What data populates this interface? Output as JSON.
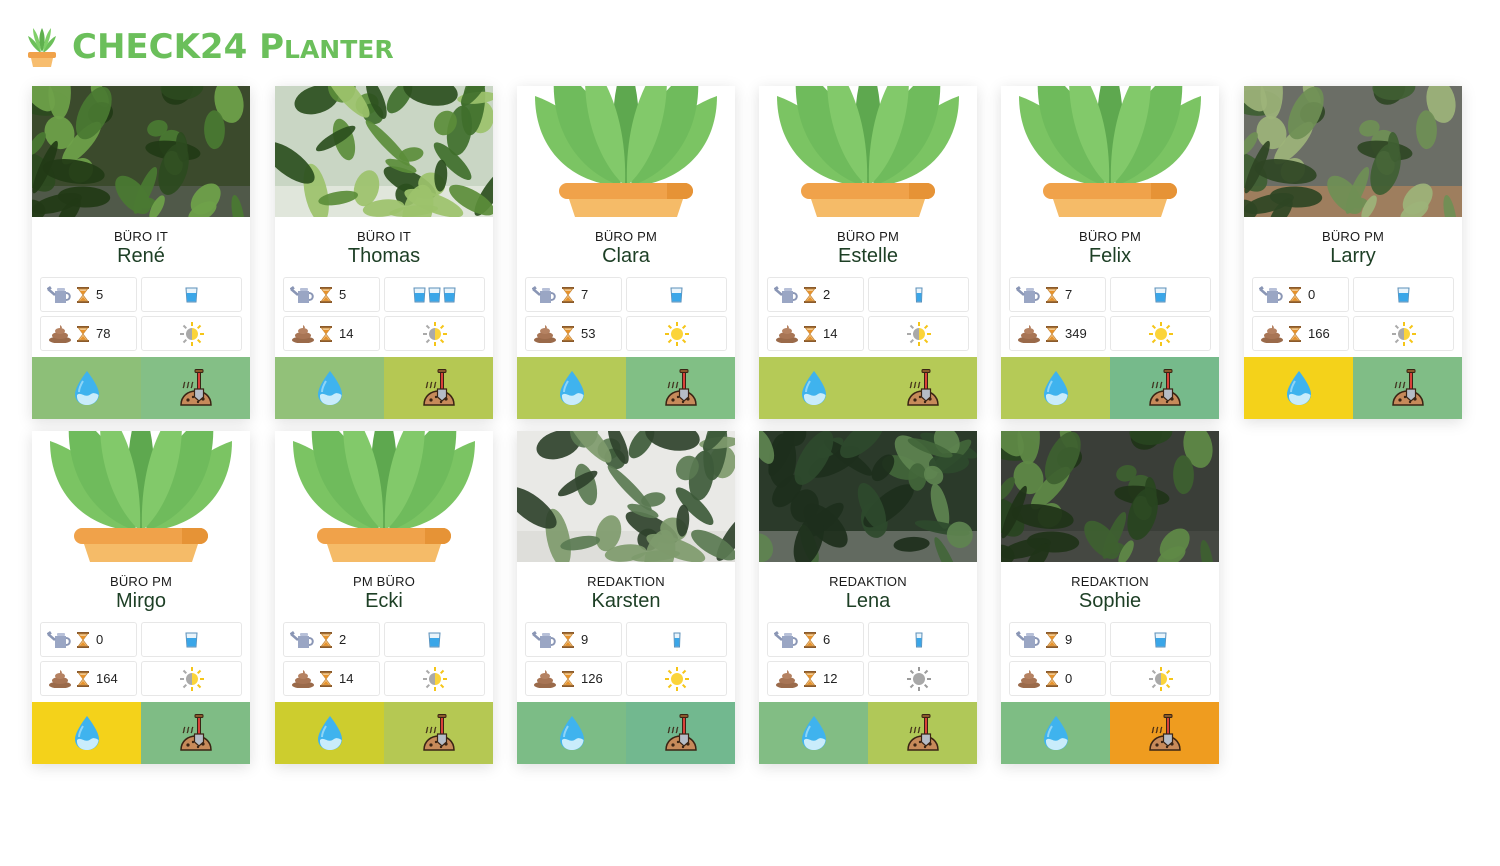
{
  "app": {
    "title_main": "CHECK24",
    "title_sub": "Planter"
  },
  "colors": {
    "brand": "#6bbf5b"
  },
  "plants": [
    {
      "location": "BÜRO IT",
      "name": "René",
      "water_days": "5",
      "water_level": 1,
      "fert_days": "78",
      "light": "half",
      "photo": "photo-shrub",
      "water_btn": "#8dbf78",
      "soil_btn": "#84bf86"
    },
    {
      "location": "BÜRO IT",
      "name": "Thomas",
      "water_days": "5",
      "water_level": 3,
      "fert_days": "14",
      "light": "half",
      "photo": "photo-tree",
      "water_btn": "#92c179",
      "soil_btn": "#b5c853"
    },
    {
      "location": "BÜRO PM",
      "name": "Clara",
      "water_days": "7",
      "water_level": 1,
      "fert_days": "53",
      "light": "full",
      "photo": "placeholder",
      "water_btn": "#b5ca57",
      "soil_btn": "#81bf85"
    },
    {
      "location": "BÜRO PM",
      "name": "Estelle",
      "water_days": "2",
      "water_level": 0.5,
      "fert_days": "14",
      "light": "half",
      "photo": "placeholder",
      "water_btn": "#b5ca57",
      "soil_btn": "#b5ca57"
    },
    {
      "location": "BÜRO PM",
      "name": "Felix",
      "water_days": "7",
      "water_level": 1,
      "fert_days": "349",
      "light": "full",
      "photo": "placeholder",
      "water_btn": "#b5ca57",
      "soil_btn": "#76ba8b"
    },
    {
      "location": "BÜRO PM",
      "name": "Larry",
      "water_days": "0",
      "water_level": 1,
      "fert_days": "166",
      "light": "half",
      "photo": "photo-snake",
      "water_btn": "#f4d21a",
      "soil_btn": "#80bd86"
    },
    {
      "location": "BÜRO PM",
      "name": "Mirgo",
      "water_days": "0",
      "water_level": 1,
      "fert_days": "164",
      "light": "half",
      "photo": "placeholder",
      "water_btn": "#f4d21a",
      "soil_btn": "#7fbc85"
    },
    {
      "location": "PM BÜRO",
      "name": "Ecki",
      "water_days": "2",
      "water_level": 1,
      "fert_days": "14",
      "light": "half",
      "photo": "placeholder",
      "water_btn": "#cdcd2e",
      "soil_btn": "#b5c853"
    },
    {
      "location": "REDAKTION",
      "name": "Karsten",
      "water_days": "9",
      "water_level": 0.5,
      "fert_days": "126",
      "light": "full",
      "photo": "photo-aloe",
      "water_btn": "#7cbc86",
      "soil_btn": "#72b88f"
    },
    {
      "location": "REDAKTION",
      "name": "Lena",
      "water_days": "6",
      "water_level": 0.5,
      "fert_days": "12",
      "light": "gray",
      "photo": "photo-rubber",
      "water_btn": "#82bd84",
      "soil_btn": "#b0c858"
    },
    {
      "location": "REDAKTION",
      "name": "Sophie",
      "water_days": "9",
      "water_level": 1,
      "fert_days": "0",
      "light": "half",
      "photo": "photo-yucca",
      "water_btn": "#7ebd84",
      "soil_btn": "#ef9c1f"
    }
  ]
}
